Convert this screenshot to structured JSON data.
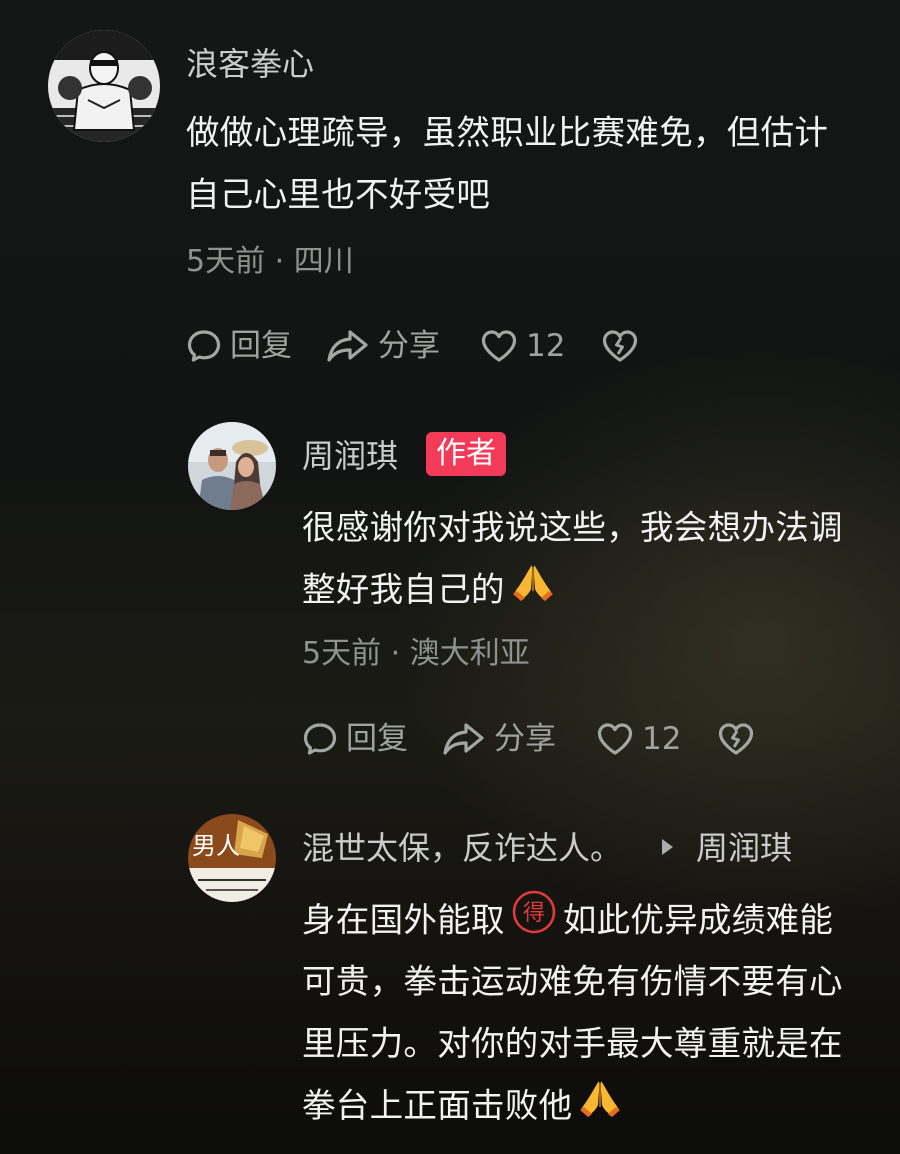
{
  "comments": [
    {
      "username": "浪客拳心",
      "avatar_icon": "boxer-avatar",
      "lines": [
        "做做心理疏导，虽然职业比赛难免，但估计",
        "自己心里也不好受吧"
      ],
      "meta": "5天前 · 四川",
      "actions": {
        "reply": "回复",
        "share": "分享",
        "likes": "12"
      }
    },
    {
      "username": "周润琪",
      "badge": "作者",
      "avatar_icon": "couple-photo-avatar",
      "lines": [
        "很感谢你对我说这些，我会想办法调",
        "整好我自己的"
      ],
      "emoji": "folded-hands-emoji",
      "meta": "5天前 · 澳大利亚",
      "actions": {
        "reply": "回复",
        "share": "分享",
        "likes": "12"
      }
    },
    {
      "username": "混世太保，反诈达人。",
      "reply_to": "周润琪",
      "avatar_icon": "men-badge-avatar",
      "avatar_text": "男人",
      "line1_a": "身在国外能取",
      "stamp_char": "得",
      "line1_b": "如此优异成绩难能",
      "lines": [
        "可贵，拳击运动难免有伤情不要有心",
        "里压力。对你的对手最大尊重就是在",
        "拳台上正面击败他"
      ],
      "emoji": "folded-hands-emoji"
    }
  ],
  "colors": {
    "text_primary": "#f1f2f1",
    "text_secondary": "#8f9390",
    "author_badge": "#f13b58",
    "stamp_red": "#e23a3a"
  }
}
